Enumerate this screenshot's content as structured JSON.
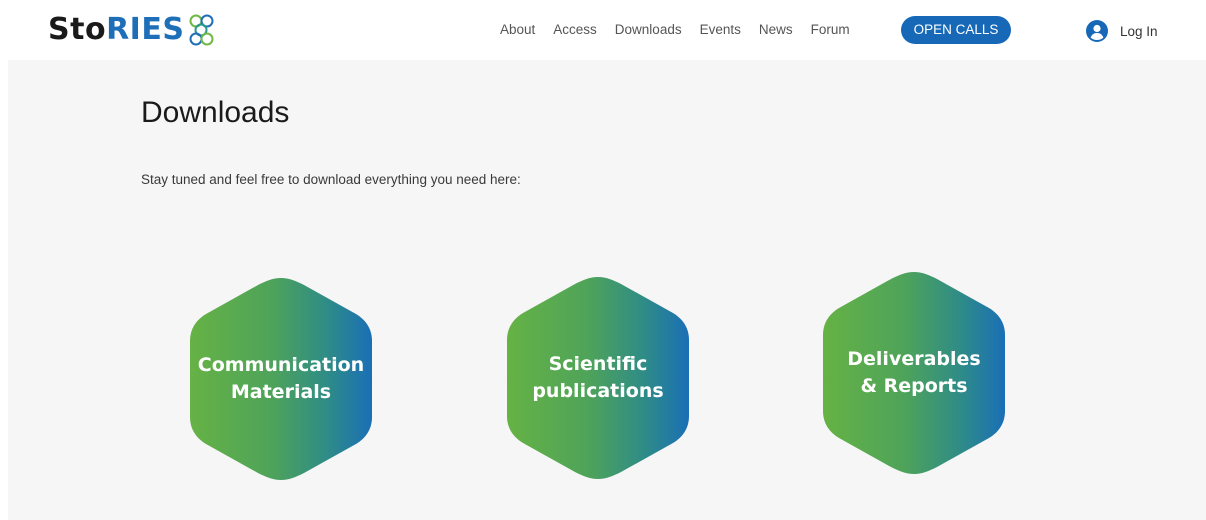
{
  "header": {
    "logo": {
      "text_part1": "Sto",
      "text_part2": "RIES",
      "mark_letters": [
        "AL",
        "BO",
        "EU",
        "RO"
      ]
    },
    "nav": [
      {
        "label": "About"
      },
      {
        "label": "Access"
      },
      {
        "label": "Downloads"
      },
      {
        "label": "Events"
      },
      {
        "label": "News"
      },
      {
        "label": "Forum"
      }
    ],
    "cta_label": "OPEN CALLS",
    "login": {
      "label": "Log In",
      "icon": "user-avatar-icon"
    }
  },
  "main": {
    "title": "Downloads",
    "intro": "Stay tuned and feel free to download everything you need here:",
    "tiles": [
      {
        "label": "Communication\nMaterials"
      },
      {
        "label": "Scientific\npublications"
      },
      {
        "label": "Deliverables\n& Reports"
      }
    ]
  },
  "colors": {
    "brand_blue": "#1769b8",
    "gradient_green": "#66b245",
    "gradient_blue": "#1a6fb6",
    "background": "#f6f6f6"
  }
}
